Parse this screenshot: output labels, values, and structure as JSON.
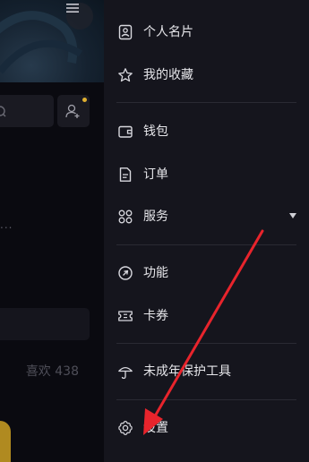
{
  "background_page": {
    "likes_label": "喜欢",
    "likes_count": "438",
    "truncation_text": "..."
  },
  "drawer": {
    "items": [
      {
        "label": "个人名片",
        "icon": "id-card-icon"
      },
      {
        "label": "我的收藏",
        "icon": "star-icon"
      },
      {
        "label": "钱包",
        "icon": "wallet-icon"
      },
      {
        "label": "订单",
        "icon": "order-document-icon"
      },
      {
        "label": "服务",
        "icon": "services-grid-icon",
        "expandable": true
      },
      {
        "label": "功能",
        "icon": "function-link-icon"
      },
      {
        "label": "卡券",
        "icon": "coupon-icon"
      },
      {
        "label": "未成年保护工具",
        "icon": "umbrella-icon"
      },
      {
        "label": "设置",
        "icon": "gear-icon"
      }
    ]
  },
  "colors": {
    "drawer_background": "#15151d",
    "annotation_arrow": "#e8242c",
    "notification_dot": "#e0b030"
  }
}
